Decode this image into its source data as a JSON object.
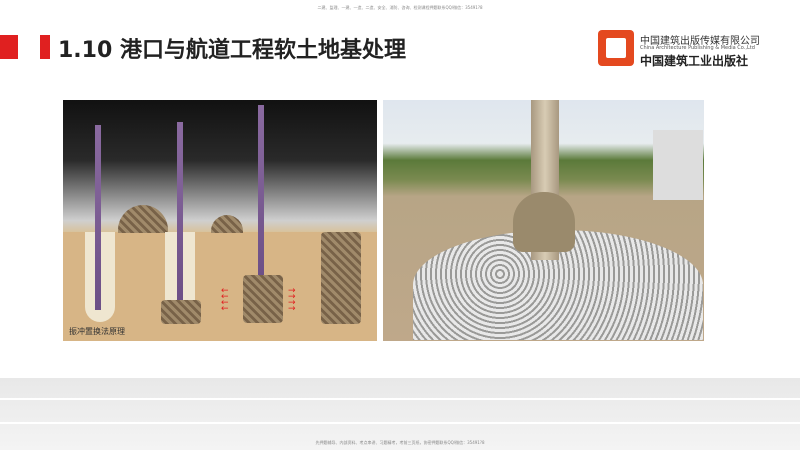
{
  "watermark_top": "二建、监理、一建、一造、二造、安全、消防、咨询、检测课程押题联系QQ/微信：35491?8",
  "watermark_bottom": "先押题辅导、内部资料、考点串讲、习题精考，考前三页纸，协密押题联系QQ/微信：35491?8",
  "title": "1.10 港口与航道工程软土地基处理",
  "logo": {
    "name_cn": "中国建筑出版传媒有限公司",
    "name_en": "China Architecture Publishing & Media Co.,Ltd",
    "name_cn2": "中国建筑工业出版社"
  },
  "figure_left": {
    "caption": "振冲置换法原理"
  },
  "colors": {
    "accent": "#e02020",
    "logo": "#e4491f"
  }
}
